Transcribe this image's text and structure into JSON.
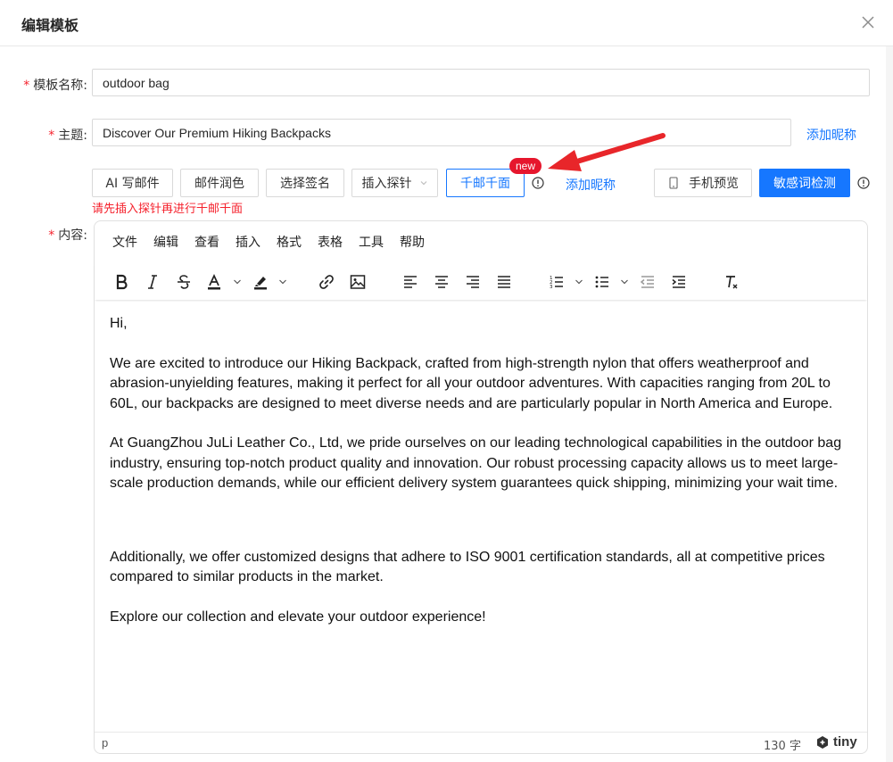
{
  "dialog": {
    "title": "编辑模板"
  },
  "form": {
    "name_label": "模板名称:",
    "name_value": "outdoor bag",
    "subject_label": "主题:",
    "subject_value": "Discover Our Premium Hiking Backpacks",
    "subject_link": "添加昵称",
    "content_label": "内容:",
    "required_mark": "*"
  },
  "toolbar_buttons": {
    "ai_write": "AI 写邮件",
    "polish": "邮件润色",
    "signature": "选择签名",
    "insert_probe": "插入探针",
    "personalize": "千邮千面",
    "new_badge": "new",
    "add_nickname": "添加昵称",
    "mobile_preview": "手机预览",
    "sensitive_check": "敏感词检测"
  },
  "error_message": "请先插入探针再进行千邮千面",
  "editor": {
    "menu": [
      "文件",
      "编辑",
      "查看",
      "插入",
      "格式",
      "表格",
      "工具",
      "帮助"
    ],
    "content": [
      "Hi,",
      "We are excited to introduce our Hiking Backpack, crafted from high-strength nylon that offers weatherproof and abrasion-unyielding features, making it perfect for all your outdoor adventures. With capacities ranging from 20L to 60L, our backpacks are designed to meet diverse needs and are particularly popular in North America and Europe.",
      "At GuangZhou JuLi Leather Co., Ltd, we pride ourselves on our leading technological capabilities in the outdoor bag industry, ensuring top-notch product quality and innovation. Our robust processing capacity allows us to meet large-scale production demands, while our efficient delivery system guarantees quick shipping, minimizing your wait time.",
      "Additionally, we offer customized designs that adhere to ISO 9001 certification standards, all at competitive prices compared to similar products in the market.",
      "Explore our collection and elevate your outdoor experience!"
    ],
    "status_path": "p",
    "word_count": "130 字",
    "brand": "tiny"
  },
  "colors": {
    "primary": "#1677ff",
    "danger": "#f5222d",
    "badge": "#e6162d",
    "arrow": "#e8262a"
  }
}
